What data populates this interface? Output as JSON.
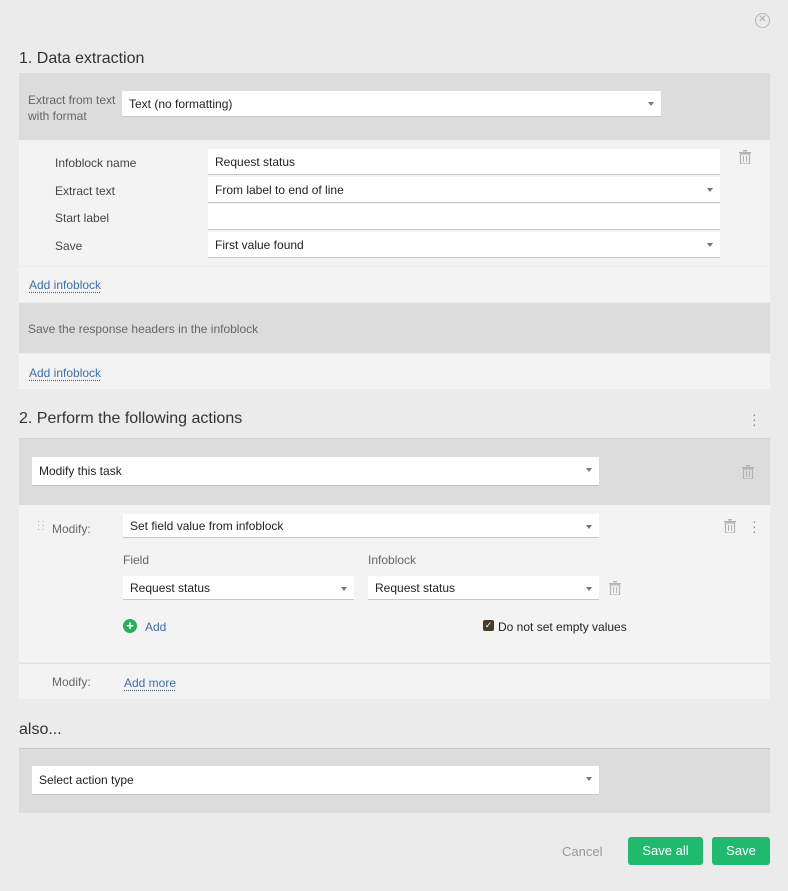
{
  "section1": {
    "title": "1. Data extraction",
    "extract_label": "Extract from text with format",
    "format_value": "Text (no formatting)",
    "infoblock": {
      "name_label": "Infoblock name",
      "name_value": "Request status",
      "extract_label": "Extract text",
      "extract_value": "From label to end of line",
      "start_label": "Start label",
      "start_value": "",
      "save_label": "Save",
      "save_value": "First value found"
    },
    "add_infoblock_1": "Add infoblock",
    "headers_text": "Save the response headers in the infoblock",
    "add_infoblock_2": "Add infoblock"
  },
  "section2": {
    "title": "2. Perform the following actions",
    "action_value": "Modify this task",
    "modify_label": "Modify:",
    "modify_value": "Set field value from infoblock",
    "field_header": "Field",
    "infoblock_header": "Infoblock",
    "field_value": "Request status",
    "infoblock_value": "Request status",
    "add_label": "Add",
    "checkbox_label": "Do not set empty values",
    "checkbox_checked": true,
    "modify_label_2": "Modify:",
    "add_more": "Add more"
  },
  "also": {
    "title": "also...",
    "select_placeholder": "Select action type"
  },
  "footer": {
    "cancel": "Cancel",
    "save_all": "Save all",
    "save": "Save"
  },
  "colors": {
    "accent": "#1fba6e",
    "link": "#3d6fa8"
  }
}
